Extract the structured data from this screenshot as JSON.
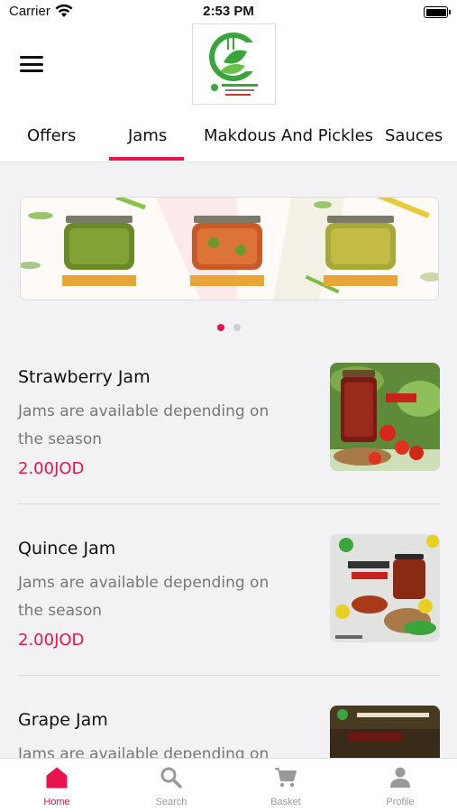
{
  "status_bar": {
    "carrier": "Carrier",
    "time": "2:53 PM",
    "battery_level": 1.0
  },
  "header": {
    "menu_icon": "hamburger-menu-icon",
    "logo_icon": "store-logo"
  },
  "tabs": [
    {
      "label": "Offers",
      "active": false
    },
    {
      "label": "Jams",
      "active": true
    },
    {
      "label": "Makdous And Pickles",
      "active": false
    },
    {
      "label": "Sauces",
      "active": false
    }
  ],
  "banner": {
    "slide_count": 2,
    "active_slide": 1
  },
  "products": [
    {
      "name": "Strawberry Jam",
      "description": "Jams are available depending on the season",
      "price": "2.00JOD"
    },
    {
      "name": "Quince Jam",
      "description": "Jams are available depending on the season",
      "price": "2.00JOD"
    },
    {
      "name": "Grape Jam",
      "description": "Jams are available depending on the season",
      "price": ""
    }
  ],
  "bottom_nav": [
    {
      "label": "Home",
      "icon": "home-icon",
      "active": true
    },
    {
      "label": "Search",
      "icon": "search-icon",
      "active": false
    },
    {
      "label": "Basket",
      "icon": "cart-icon",
      "active": false
    },
    {
      "label": "Profile",
      "icon": "profile-icon",
      "active": false
    }
  ],
  "colors": {
    "accent": "#e8134a",
    "inactive": "#999999",
    "background": "#f2f2f4",
    "logo_green": "#3aa53a"
  }
}
